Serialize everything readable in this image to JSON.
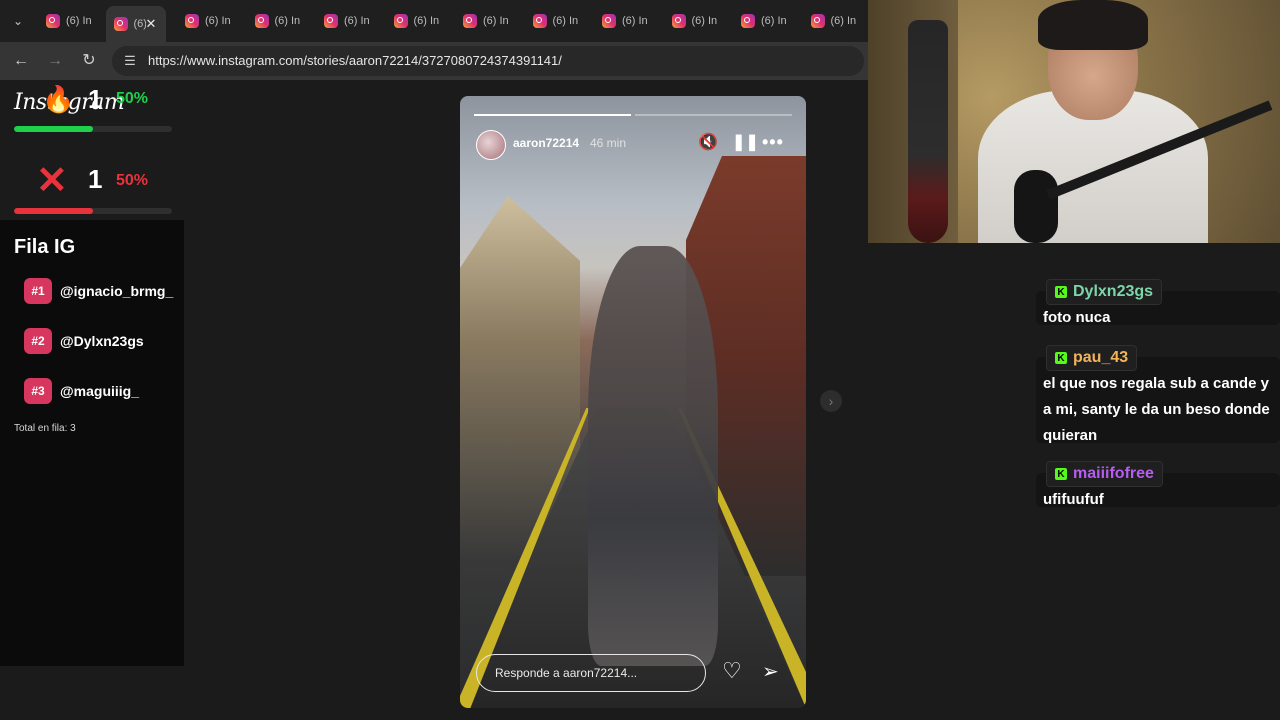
{
  "browser": {
    "tabs": [
      {
        "title": "(6) In",
        "active": false
      },
      {
        "title": "(6) I",
        "active": true
      },
      {
        "title": "(6) In",
        "active": false
      },
      {
        "title": "(6) In",
        "active": false
      },
      {
        "title": "(6) In",
        "active": false
      },
      {
        "title": "(6) In",
        "active": false
      },
      {
        "title": "(6) In",
        "active": false
      },
      {
        "title": "(6) In",
        "active": false
      },
      {
        "title": "(6) In",
        "active": false
      },
      {
        "title": "(6) In",
        "active": false
      },
      {
        "title": "(6) In",
        "active": false
      },
      {
        "title": "(6) In",
        "active": false
      }
    ],
    "url": "https://www.instagram.com/stories/aaron72214/3727080724374391141/"
  },
  "stats": {
    "logo_text": "Instagram",
    "ig_count": "1",
    "ig_percent": "50%",
    "ig_fraction": 0.5,
    "x_count": "1",
    "x_percent": "50%",
    "x_fraction": 0.5,
    "green": "#1fd14a",
    "red": "#e8323c"
  },
  "queue": {
    "title": "Fila IG",
    "items": [
      {
        "rank": "#1",
        "name": "@ignacio_brmg_"
      },
      {
        "rank": "#2",
        "name": "@Dylxn23gs"
      },
      {
        "rank": "#3",
        "name": "@maguiiig_"
      }
    ],
    "total": "Total en fila: 3",
    "badge_color": "#d7365e"
  },
  "story": {
    "username": "aaron72214",
    "time": "46 min",
    "reply_placeholder": "Responde a aaron72214...",
    "progress_segments": 2,
    "progress_done": 1
  },
  "chat": {
    "messages": [
      {
        "user": "Dylxn23gs",
        "color": "#7dd6a9",
        "text": "foto nuca"
      },
      {
        "user": "pau_43",
        "color": "#f2b35a",
        "text": "el que nos regala sub a cande y a mi, santy le da un beso donde quieran"
      },
      {
        "user": "maiiifofree",
        "color": "#b75cf2",
        "text": "ufifuufuf"
      }
    ],
    "kick_letter": "K"
  }
}
